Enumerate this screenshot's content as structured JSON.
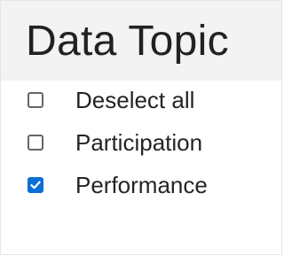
{
  "filter": {
    "title": "Data Topic",
    "items": [
      {
        "label": "Deselect all",
        "checked": false
      },
      {
        "label": "Participation",
        "checked": false
      },
      {
        "label": "Performance",
        "checked": true
      }
    ]
  },
  "colors": {
    "header_bg": "#f3f3f3",
    "checkbox_checked": "#0b6fd6",
    "checkbox_border": "#666666",
    "text": "#252423"
  }
}
